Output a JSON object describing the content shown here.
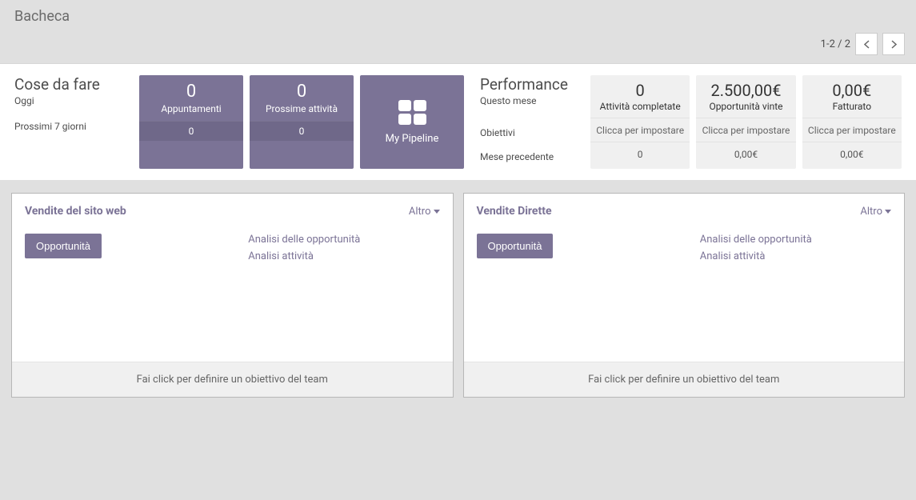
{
  "header": {
    "title": "Bacheca",
    "pager": {
      "counter": "1-2 / 2"
    }
  },
  "todo": {
    "heading": "Cose da fare",
    "today_label": "Oggi",
    "next7_label": "Prossimi 7 giorni",
    "tiles": {
      "appointments": {
        "value": "0",
        "label": "Appuntamenti",
        "next7": "0"
      },
      "next_activities": {
        "value": "0",
        "label": "Prossime attività",
        "next7": "0"
      },
      "pipeline": {
        "label": "My Pipeline"
      }
    }
  },
  "performance": {
    "heading": "Performance",
    "sub": "Questo mese",
    "goals_label": "Obiettivi",
    "prev_month_label": "Mese precedente",
    "cards": {
      "completed": {
        "value": "0",
        "label": "Attività completate",
        "click": "Clicca per impostare",
        "prev": "0"
      },
      "won": {
        "value": "2.500,00€",
        "label": "Opportunità vinte",
        "click": "Clicca per impostare",
        "prev": "0,00€"
      },
      "invoiced": {
        "value": "0,00€",
        "label": "Fatturato",
        "click": "Clicca per impostare",
        "prev": "0,00€"
      }
    }
  },
  "panels": {
    "web": {
      "title": "Vendite del sito web",
      "menu": "Altro",
      "btn": "Opportunità",
      "link1": "Analisi delle opportunità",
      "link2": "Analisi attività",
      "footer": "Fai click per definire un obiettivo del team"
    },
    "direct": {
      "title": "Vendite Dirette",
      "menu": "Altro",
      "btn": "Opportunità",
      "link1": "Analisi delle opportunità",
      "link2": "Analisi attività",
      "footer": "Fai click per definire un obiettivo del team"
    }
  }
}
